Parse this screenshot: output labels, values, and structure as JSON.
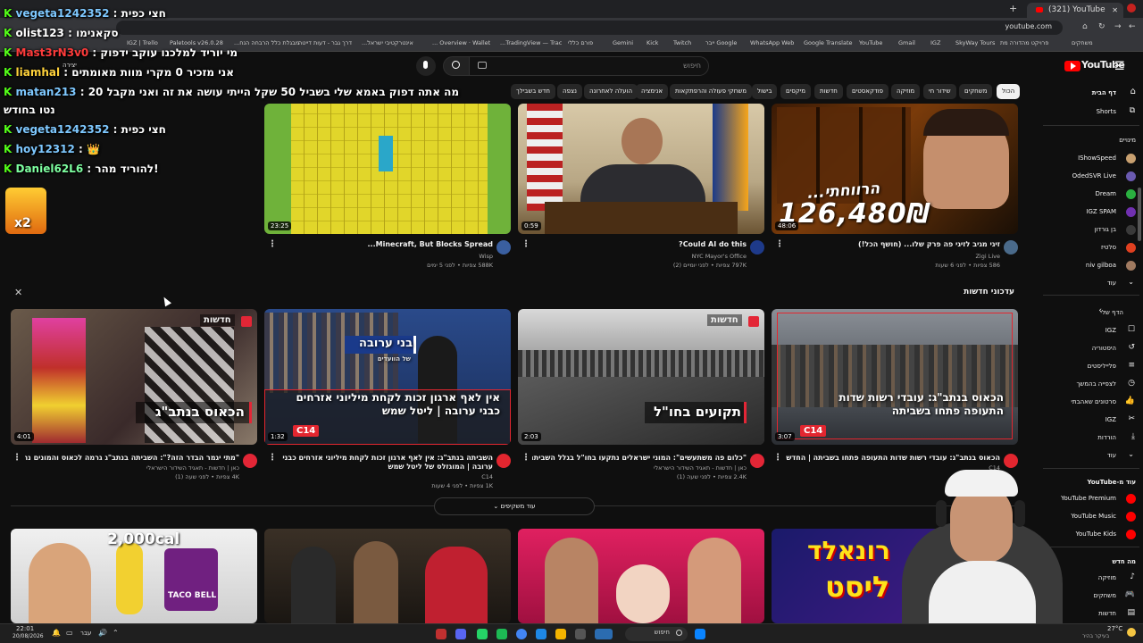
{
  "browser": {
    "tab_title": "(321) YouTube",
    "url": "youtube.com",
    "bookmarks": [
      "IGZ | Trello",
      "Paletools v26.0.28",
      "מבגלת כלל הרבחה הנח...",
      "דרך גבר - דעות דייטה",
      "אינטרקטיבי ישראל...",
      "Overview · Wallet ...",
      "TradingView — Trac...",
      "פורם כללי",
      "Gemini",
      "Kick",
      "Twitch",
      "Google ייבר",
      "WhatsApp Web",
      "Google Translate",
      "YouTube",
      "Gmail",
      "IGZ",
      "SkyWay Tours",
      "פרויקט מהדורה מת",
      "משחקים"
    ]
  },
  "header": {
    "logo": "YouTube",
    "search_placeholder": "חיפוש",
    "create_label": "יצירה"
  },
  "chips": [
    {
      "label": "הכול",
      "selected": true
    },
    {
      "label": "משחקים"
    },
    {
      "label": "שידור חי"
    },
    {
      "label": "מוזיקה"
    },
    {
      "label": "פודקאסטים"
    },
    {
      "label": "חדשות"
    },
    {
      "label": "מיקסים"
    },
    {
      "label": "בישול"
    },
    {
      "label": "משחקי פעולה והרפתקאות"
    },
    {
      "label": "אנימציה"
    },
    {
      "label": "הועלה לאחרונה"
    },
    {
      "label": "נצפה"
    },
    {
      "label": "חדש בשבילך"
    }
  ],
  "top_videos": [
    {
      "title": "זיגי מגיב לזיגי פה פרק שלו... (חושף הכל!)",
      "channel": "Zigi Live",
      "meta": "586 צפיות • לפני 6 שעות",
      "duration": "48:06",
      "overlay": "126,480₪",
      "overlay2": "הרווחתי..."
    },
    {
      "title": "Could AI do this?",
      "channel": "NYC Mayor's Office",
      "meta": "797K צפיות • לפני יומיים (2)",
      "duration": "0:59"
    },
    {
      "title": "Minecraft, But Blocks Spread...",
      "channel": "Wisp",
      "meta": "588K צפיות • לפני 5 ימים",
      "duration": "23:25"
    }
  ],
  "news_section": {
    "heading": "עדכוני חדשות",
    "more_label": "עוד משקיפים",
    "items": [
      {
        "title": "הכאוס בנתב\"ג: עובדי רשות שדות התעופה פתחו בשביתה | החדשות",
        "channel": "C14",
        "meta": "1.1K צפיות • לפני שעה",
        "duration": "3:07",
        "overlay": "הכאוס בנתב\"ג: עובדי רשות שדות התעופה פתחו בשביתה",
        "badge": "C14"
      },
      {
        "title": "\"כלום פה משתעשים\": המוני ישראלים נתקעו בחו\"ל בגלל השביתה בנתב\"ג",
        "channel": "כאן | חדשות - תאגיד השידור הישראלי",
        "meta": "2.4K צפיות • לפני שעה (1)",
        "duration": "2:03",
        "overlay": "תקועים בחו\"ל",
        "badge_news": "חדשות"
      },
      {
        "title": "השביתה בנתב\"ג: אין לאף ארגון זכות לקחת מיליוני אזרחים כבני ערובה | המוגזלס של ליטל שמש",
        "channel": "C14",
        "meta": "1K צפיות • לפני 4 שעות",
        "duration": "1:32",
        "overlay": "אין לאף ארגון זכות לקחת מיליוני אזרחים כבני ערובה | ליטל שמש",
        "overlay_top": "בני ערובה",
        "overlay_sub": "של הוועדים",
        "badge": "C14"
      },
      {
        "title": "\"מתי יגמר הבדר הזה?\": השביתה בנתב\"ג גרמה לכאוס והמונים נתקעו",
        "channel": "כאן | חדשות - תאגיד השידור הישראלי",
        "meta": "4K צפיות • לפני שעה (1)",
        "duration": "4:01",
        "overlay": "הכאוס בנתב\"ג",
        "badge_news": "חדשות"
      }
    ]
  },
  "bottom_row": {
    "overlays": [
      "רונאלד",
      "ליסט",
      "2,000cal",
      "TACO BELL"
    ]
  },
  "sidebar": {
    "home": "דף הבית",
    "shorts": "Shorts",
    "subs_heading": "מינויים",
    "subs": [
      "IShowSpeed",
      "OdedSVR Live",
      "Dream",
      "IGZ SPAM",
      "בן גורדון",
      "סלטיז",
      "niv gilboa"
    ],
    "more": "עוד",
    "you_heading": "הדף שלי",
    "you_items": [
      "IGZ",
      "היסטוריה",
      "פלייליסטים",
      "לצפייה בהמשך",
      "סרטונים שאהבתי",
      "IGZ",
      "הורדות"
    ],
    "more2": "עוד",
    "more_from": "עוד מ-YouTube",
    "yt_items": [
      "YouTube Premium",
      "YouTube Music",
      "YouTube Kids"
    ],
    "explore": "מה חדש",
    "explore_items": [
      "מוזיקה",
      "משחקים",
      "חדשות"
    ]
  },
  "chat": [
    {
      "user": "vegeta1242352",
      "msg": "חצי כפית"
    },
    {
      "user": "olist123",
      "msg": "סקאנימו"
    },
    {
      "user": "Mast3rN3v0",
      "msg": "מי יוריד למלכנו עוקב ידפוק"
    },
    {
      "user": "liamhal",
      "msg": "אני מזכיר 0 מקרי מוות מאומתים"
    },
    {
      "user": "matan213",
      "msg": "20 מה אתה דפוק באמא שלי בשביל 50 שקל הייתי עושה את זה ואני מקבל"
    },
    {
      "user": "",
      "msg": "נטו בחודש"
    },
    {
      "user": "vegeta1242352",
      "msg": "חצי כפית"
    },
    {
      "user": "hoy12312",
      "msg": "👑"
    },
    {
      "user": "Daniel62L6",
      "msg": "להוריד מהר!"
    }
  ],
  "emote_label": "x2",
  "taskbar": {
    "time": "22:01",
    "date": "20/08/2026",
    "search": "חיפוש",
    "lang": "עבר",
    "weather": "27°C",
    "weather_desc": "בעיקר בהיר"
  },
  "colors": {
    "bg": "#0f0f0f",
    "accent": "#ff0000",
    "kick": "#53fc18",
    "c14": "#e3262f"
  }
}
